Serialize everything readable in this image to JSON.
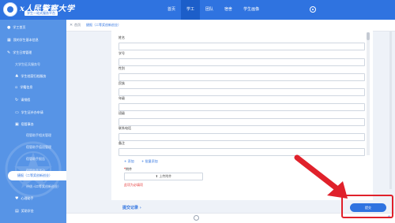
{
  "header": {
    "school_name": "ⅹ人民警察大学",
    "school_subtitle": "学生一站式服务平台",
    "nav": [
      "首页",
      "学工",
      "团队",
      "宿舍",
      "学生画像"
    ],
    "active_nav": "学工"
  },
  "sidebar": {
    "items": [
      {
        "label": "学工首页",
        "icon": "●"
      },
      {
        "label": "我的学生基本信息",
        "icon": "▦"
      },
      {
        "label": "学生日常管理",
        "icon": "✎"
      },
      {
        "label": "大学生征兵服务号",
        "icon": ""
      },
      {
        "label": "学生档案归档服务",
        "icon": "♣"
      },
      {
        "label": "学籍信息",
        "icon": "▫"
      },
      {
        "label": "请销假",
        "icon": "↻"
      },
      {
        "label": "学生证补办申请",
        "icon": "▭"
      },
      {
        "label": "宿管事务",
        "icon": "▣"
      },
      {
        "label": "宿管助手相关管理",
        "icon": ""
      },
      {
        "label": "宿管助手值班管理",
        "icon": ""
      },
      {
        "label": "宿管助手报告",
        "icon": ""
      },
      {
        "label": "宿管助手活动",
        "icon": ""
      },
      {
        "label": "捷报（二等奖创新创业）",
        "icon": ""
      },
      {
        "label": "评优（二等奖创新创业）",
        "icon": ""
      },
      {
        "label": "心理助手",
        "icon": "♥"
      },
      {
        "label": "奖助学金",
        "icon": "▤"
      }
    ]
  },
  "breadcrumb": {
    "home": "首页",
    "current": "捷报（二等奖创新创业）"
  },
  "form": {
    "fields": [
      "姓名",
      "学号",
      "性别",
      "民族",
      "年级",
      "班级",
      "联系电话",
      "备注"
    ],
    "add_link": "+ 添加",
    "batch_add_link": "+ 批量添加",
    "attachment_label": "附件",
    "upload_button": "上传附件",
    "hint": "此项为必填项"
  },
  "footer": {
    "records_link": "提交记录 ›",
    "submit_label": "提交"
  },
  "colors": {
    "primary": "#2f73e0",
    "sidebar": "#5794e6",
    "highlight": "#e0212b"
  }
}
